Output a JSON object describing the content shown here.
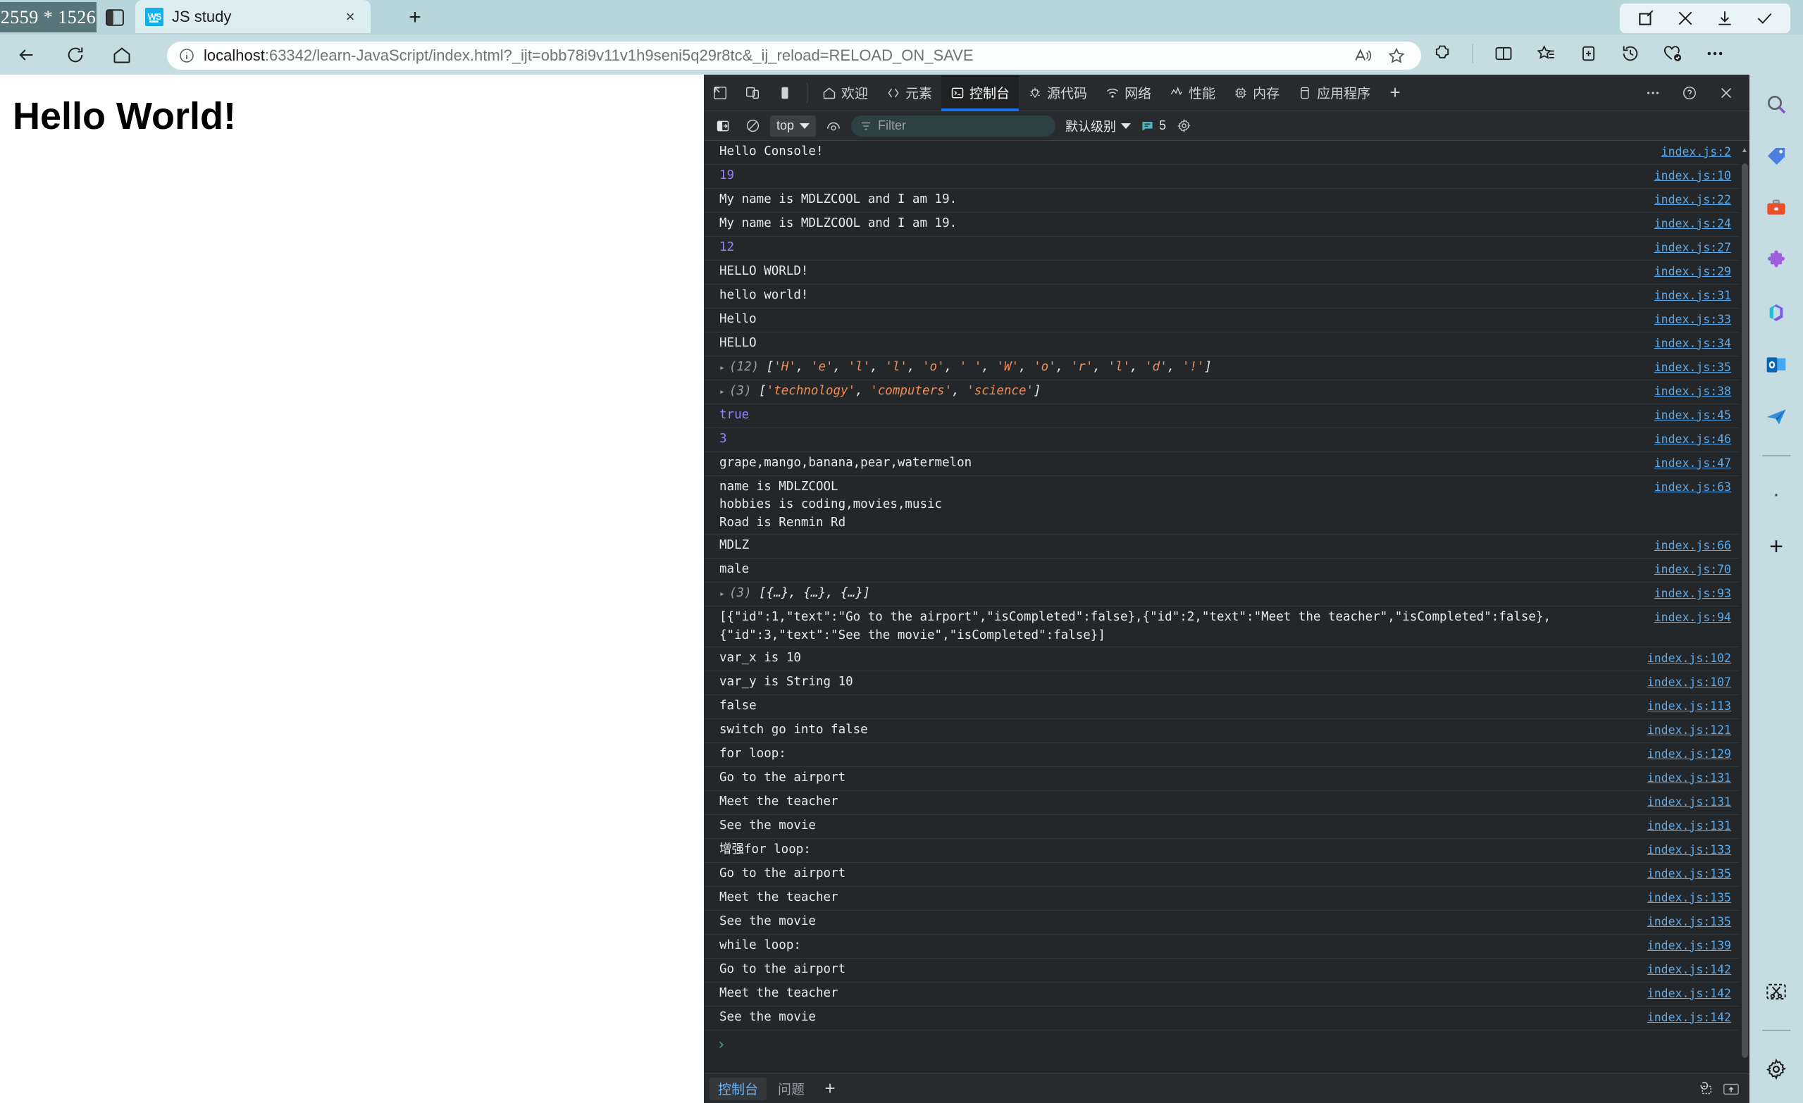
{
  "window": {
    "overlay_size_label": "2559 * 1526",
    "controls": [
      "edit-icon",
      "close-icon",
      "download-icon",
      "confirm-icon"
    ]
  },
  "tab": {
    "title": "JS study",
    "favicon_label": "WS",
    "close_label": "×",
    "newtab_label": "+"
  },
  "nav": {
    "back_label": "←",
    "reload_label": "↻",
    "home_label": "⌂"
  },
  "omnibox": {
    "host": "localhost",
    "rest": ":63342/learn-JavaScript/index.html?_ijt=obb78i9v11v1h9seni5q29r8tc&_ij_reload=RELOAD_ON_SAVE",
    "info_icon": "info-icon",
    "read_aloud_icon": "read-aloud-icon",
    "favorite_icon": "star-icon"
  },
  "toolbar_icons": [
    "extensions-icon",
    "split-screen-icon",
    "collections-star-icon",
    "collections-icon",
    "history-icon",
    "browser-essentials-icon",
    "settings-more-icon"
  ],
  "page": {
    "heading": "Hello World!"
  },
  "devtools": {
    "left_buttons": [
      "inspect-icon",
      "device-toolbar-icon",
      "dock-side-icon"
    ],
    "tabs": [
      {
        "label": "欢迎",
        "icon": "home-icon",
        "active": false
      },
      {
        "label": "元素",
        "icon": "code-icon",
        "active": false
      },
      {
        "label": "控制台",
        "icon": "console-icon",
        "active": true
      },
      {
        "label": "源代码",
        "icon": "sources-icon",
        "active": false
      },
      {
        "label": "网络",
        "icon": "network-icon",
        "active": false
      },
      {
        "label": "性能",
        "icon": "performance-icon",
        "active": false
      },
      {
        "label": "内存",
        "icon": "memory-icon",
        "active": false
      },
      {
        "label": "应用程序",
        "icon": "application-icon",
        "active": false
      }
    ],
    "add_tab_label": "+",
    "more_label": "⋯",
    "help_label": "?",
    "close_label": "✕",
    "toolbar": {
      "sidebar_toggle_icon": "console-sidebar-icon",
      "clear_icon": "clear-console-icon",
      "context_value": "top",
      "eye_icon": "live-expression-icon",
      "filter_placeholder": "Filter",
      "filter_value": "",
      "filter_icon": "filter-icon",
      "levels_label": "默认级别",
      "message_count": "5",
      "message_icon": "message-bubble-icon",
      "settings_icon": "gear-icon"
    },
    "prompt_chevron": "›",
    "drawer": {
      "tabs": [
        {
          "label": "控制台",
          "active": true
        },
        {
          "label": "问题",
          "active": false
        }
      ],
      "add_label": "+",
      "right_icons": [
        "restore-drawer-icon",
        "dock-bottom-icon"
      ]
    },
    "console_rows": [
      {
        "type": "text",
        "text": "Hello Console!",
        "src": "index.js:2"
      },
      {
        "type": "number",
        "text": "19",
        "src": "index.js:10"
      },
      {
        "type": "text",
        "text": "My name is MDLZCOOL and I am 19.",
        "src": "index.js:22"
      },
      {
        "type": "text",
        "text": "My name is MDLZCOOL and I am 19.",
        "src": "index.js:24"
      },
      {
        "type": "number",
        "text": "12",
        "src": "index.js:27"
      },
      {
        "type": "text",
        "text": "HELLO WORLD!",
        "src": "index.js:29"
      },
      {
        "type": "text",
        "text": "hello world!",
        "src": "index.js:31"
      },
      {
        "type": "text",
        "text": "Hello",
        "src": "index.js:33"
      },
      {
        "type": "text",
        "text": "HELLO",
        "src": "index.js:34"
      },
      {
        "type": "array",
        "count": "(12)",
        "text": "['H', 'e', 'l', 'l', 'o', ' ', 'W', 'o', 'r', 'l', 'd', '!']",
        "src": "index.js:35"
      },
      {
        "type": "array",
        "count": "(3)",
        "text": "['technology', 'computers', 'science']",
        "src": "index.js:38"
      },
      {
        "type": "bool",
        "text": "true",
        "src": "index.js:45"
      },
      {
        "type": "number",
        "text": "3",
        "src": "index.js:46"
      },
      {
        "type": "text",
        "text": "grape,mango,banana,pear,watermelon",
        "src": "index.js:47"
      },
      {
        "type": "text",
        "text": "name is MDLZCOOL\nhobbies is coding,movies,music\nRoad is Renmin Rd",
        "src": "index.js:63"
      },
      {
        "type": "text",
        "text": "MDLZ",
        "src": "index.js:66"
      },
      {
        "type": "text",
        "text": "male",
        "src": "index.js:70"
      },
      {
        "type": "array-collapsed",
        "count": "(3)",
        "text": "[{…}, {…}, {…}]",
        "src": "index.js:93"
      },
      {
        "type": "text",
        "text": "[{\"id\":1,\"text\":\"Go to the airport\",\"isCompleted\":false},{\"id\":2,\"text\":\"Meet the teacher\",\"isCompleted\":false},\n{\"id\":3,\"text\":\"See the movie\",\"isCompleted\":false}]",
        "src": "index.js:94"
      },
      {
        "type": "text",
        "text": "var_x is 10",
        "src": "index.js:102"
      },
      {
        "type": "text",
        "text": "var_y is String 10",
        "src": "index.js:107"
      },
      {
        "type": "text",
        "text": "false",
        "src": "index.js:113"
      },
      {
        "type": "text",
        "text": "switch go into false",
        "src": "index.js:121"
      },
      {
        "type": "text",
        "text": "for loop:",
        "src": "index.js:129"
      },
      {
        "type": "text",
        "text": "Go to the airport",
        "src": "index.js:131"
      },
      {
        "type": "text",
        "text": "Meet the teacher",
        "src": "index.js:131"
      },
      {
        "type": "text",
        "text": "See the movie",
        "src": "index.js:131"
      },
      {
        "type": "text",
        "text": "增强for loop:",
        "src": "index.js:133"
      },
      {
        "type": "text",
        "text": "Go to the airport",
        "src": "index.js:135"
      },
      {
        "type": "text",
        "text": "Meet the teacher",
        "src": "index.js:135"
      },
      {
        "type": "text",
        "text": "See the movie",
        "src": "index.js:135"
      },
      {
        "type": "text",
        "text": "while loop:",
        "src": "index.js:139"
      },
      {
        "type": "text",
        "text": "Go to the airport",
        "src": "index.js:142"
      },
      {
        "type": "text",
        "text": "Meet the teacher",
        "src": "index.js:142"
      },
      {
        "type": "text",
        "text": "See the movie",
        "src": "index.js:142"
      }
    ]
  },
  "edge_sidebar": {
    "icons": [
      "search-icon",
      "shopping-tag-icon",
      "tools-briefcase-icon",
      "extensions-puzzle-icon",
      "microsoft365-icon",
      "outlook-icon",
      "telegram-send-icon"
    ],
    "dot_label": "·",
    "add_label": "+",
    "bottom_icons": [
      "screenshot-scissors-icon",
      "sidebar-settings-gear-icon"
    ]
  },
  "colors": {
    "browser_chrome": "#c5dde2",
    "tab_active": "#ddeef1",
    "devtools_bg": "#242729",
    "devtools_panel": "#282b2d",
    "accent_blue": "#1a73e8",
    "link_blue": "#5aa9ea",
    "number_purple": "#9980ff",
    "string_orange": "#f28b54"
  }
}
